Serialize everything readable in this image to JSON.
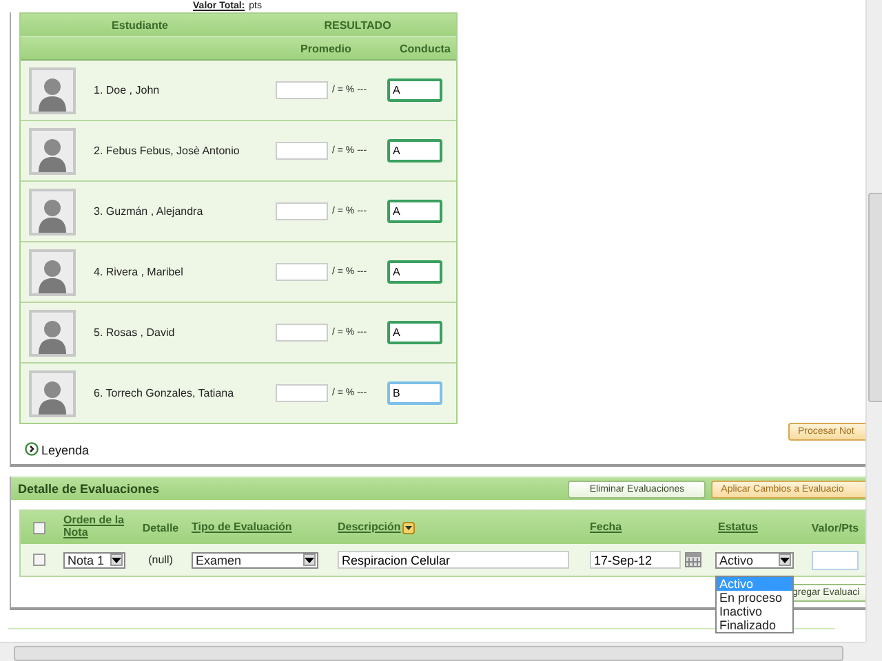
{
  "valor_total": {
    "label": "Valor Total:",
    "unit": "pts"
  },
  "students_table": {
    "columns": [
      "Estudiante",
      "RESULTADO"
    ],
    "subcolumns": [
      "Promedio",
      "Conducta"
    ],
    "rows": [
      {
        "name": "1. Doe , John",
        "suffix": "/ = % ---",
        "conducta": "A",
        "focused": false
      },
      {
        "name": "2. Febus Febus, Josè Antonio",
        "suffix": "/ = % ---",
        "conducta": "A",
        "focused": false
      },
      {
        "name": "3. Guzmán , Alejandra",
        "suffix": "/ = % ---",
        "conducta": "A",
        "focused": false
      },
      {
        "name": "4. Rivera , Maribel",
        "suffix": "/ = % ---",
        "conducta": "A",
        "focused": false
      },
      {
        "name": "5. Rosas , David",
        "suffix": "/ = % ---",
        "conducta": "A",
        "focused": false
      },
      {
        "name": "6. Torrech Gonzales, Tatiana",
        "suffix": "/ = % ---",
        "conducta": "B",
        "focused": true
      }
    ]
  },
  "process_button": "Procesar Not",
  "legend": "Leyenda",
  "evaluations": {
    "title": "Detalle de Evaluaciones",
    "buttons": [
      {
        "label": "Eliminar Evaluaciones",
        "kind": "plain"
      },
      {
        "label": "Aplicar Cambios a Evaluacio",
        "kind": "accent"
      }
    ],
    "header_checked": false,
    "columns": [
      {
        "label": "Orden de la Nota",
        "kind": "link"
      },
      {
        "label": "Detalle",
        "kind": "plain"
      },
      {
        "label": "Tipo de Evaluación",
        "kind": "link"
      },
      {
        "label": "Descripción",
        "kind": "sort"
      },
      {
        "label": "Fecha",
        "kind": "link"
      },
      {
        "label": "Estatus",
        "kind": "link"
      },
      {
        "label": "Valor/Pts",
        "kind": "plain"
      }
    ],
    "rows": [
      {
        "checked": false,
        "orden": "Nota 1",
        "detalle": "(null)",
        "tipo": "Examen",
        "descripcion": "Respiracion Celular",
        "fecha": "17-Sep-12",
        "estatus": "Activo"
      }
    ],
    "status_options": [
      {
        "label": "Activo",
        "selected": true
      },
      {
        "label": "En proceso",
        "selected": false
      },
      {
        "label": "Inactivo",
        "selected": false
      },
      {
        "label": "Finalizado",
        "selected": false
      }
    ],
    "add_button": "gregar Evaluaci"
  }
}
